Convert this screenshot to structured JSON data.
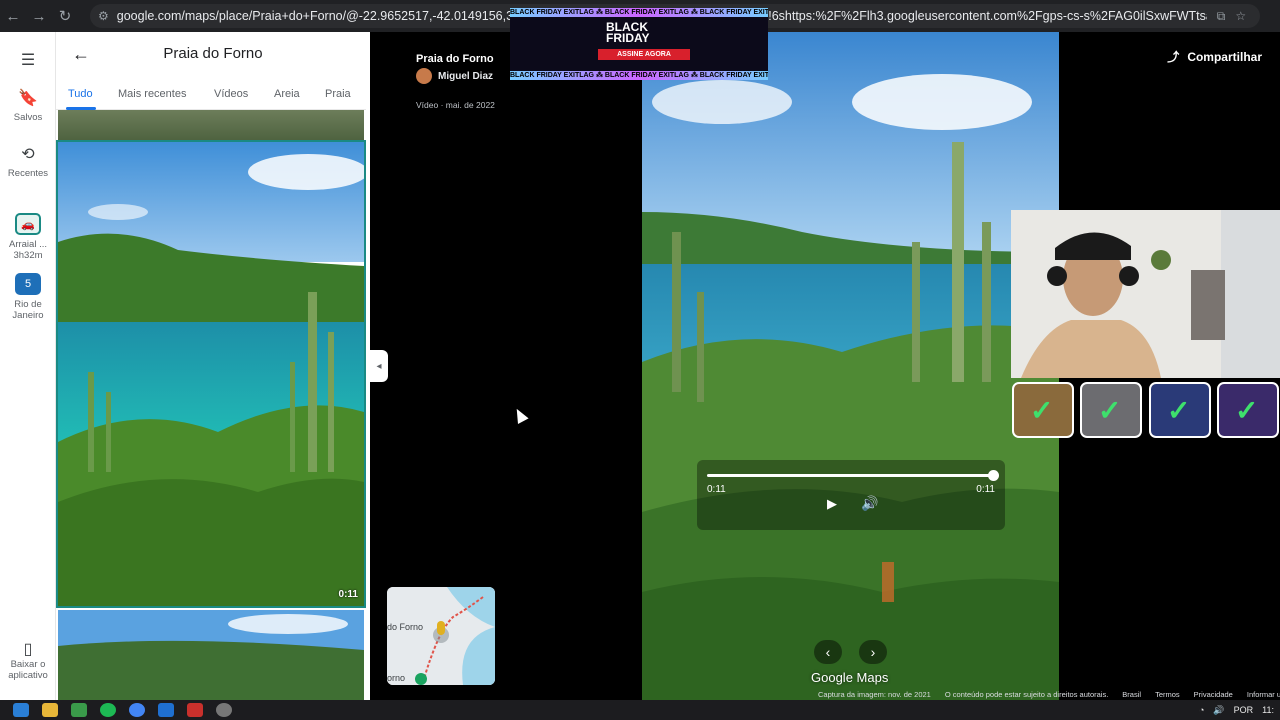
{
  "browser": {
    "url": "google.com/maps/place/Praia+do+Forno/@-22.9652517,-42.0149156,3a,75y,90t/data=!3m8!1e1!3m6!1s...!2e10!3e10!6shttps:%2F%2Flh3.googleusercontent.com%2Fgps-cs-s%2FAG0ilSxwFWTtsaae_5i..."
  },
  "rail": {
    "items": [
      {
        "label": "Salvos"
      },
      {
        "label": "Recentes"
      },
      {
        "label": "Arraial ...",
        "sub": "3h32m"
      },
      {
        "label": "Rio de Janeiro"
      },
      {
        "label": "Baixar o aplicativo"
      }
    ]
  },
  "panel": {
    "title": "Praia do Forno",
    "tabs": [
      "Tudo",
      "Mais recentes",
      "Vídeos",
      "Areia",
      "Praia"
    ],
    "active_tab": "Tudo",
    "video_duration": "0:11"
  },
  "viewer": {
    "place": "Praia do Forno",
    "author": "Miguel Diaz",
    "date": "Vídeo · mai. de 2022",
    "share_label": "Compartilhar",
    "time_current": "0:11",
    "time_total": "0:11",
    "progress": 1.0,
    "brand": "Google Maps",
    "footer": [
      "Captura da imagem: nov. de 2021",
      "O conteúdo pode estar sujeito a direitos autorais.",
      "Brasil",
      "Termos",
      "Privacidade",
      "Informar um"
    ],
    "minimap_label_1": "do Forno",
    "minimap_label_2": "orno"
  },
  "ad": {
    "ticker": "BLACK FRIDAY EXITLAG ⁂ BLACK FRIDAY EXITLAG ⁂ BLACK FRIDAY EXITLAG",
    "line1": "BLACK",
    "line2": "FRIDAY",
    "cta": "ASSINE AGORA"
  },
  "taskbar": {
    "lang": "POR",
    "time": "11:"
  },
  "colors": {
    "accent": "#1a73e8",
    "selected_border": "#1a8a84",
    "badge_check": "#3ee06c"
  }
}
